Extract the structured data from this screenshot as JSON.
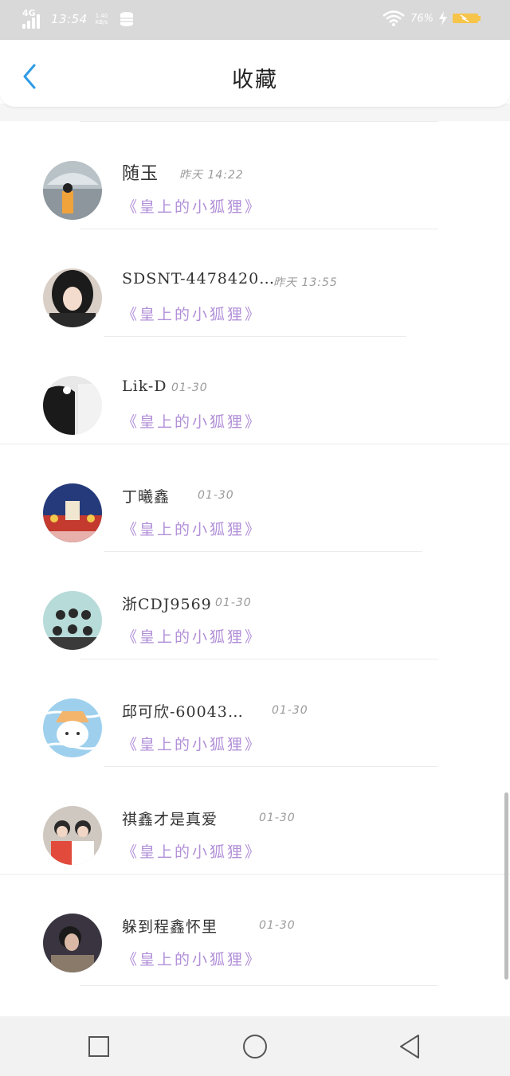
{
  "status_bar": {
    "network": "4G",
    "time": "13:54",
    "speed": "1.40 KB/s",
    "battery": "76%"
  },
  "header": {
    "title": "收藏",
    "back_icon": "chevron-left-icon"
  },
  "favorites": [
    {
      "name": "随玉",
      "date": "昨天 14:22",
      "song": "《皇上的小狐狸》",
      "avatar": "person-umbrella"
    },
    {
      "name": "SDSNT-4478420…",
      "date": "昨天 13:55",
      "song": "《皇上的小狐狸》",
      "avatar": "girl-dark-hair"
    },
    {
      "name": "Lik-D",
      "date": "01-30",
      "song": "《皇上的小狐狸》",
      "avatar": "mirror-selfie"
    },
    {
      "name": "丁曦鑫",
      "date": "01-30",
      "song": "《皇上的小狐狸》",
      "avatar": "stage-group"
    },
    {
      "name": "浙CDJ9569",
      "date": "01-30",
      "song": "《皇上的小狐狸》",
      "avatar": "boy-group"
    },
    {
      "name": "邱可欣-60043…",
      "date": "01-30",
      "song": "《皇上的小狐狸》",
      "avatar": "cartoon-bear-hat"
    },
    {
      "name": "祺鑫才是真爱",
      "date": "01-30",
      "song": "《皇上的小狐狸》",
      "avatar": "two-boys"
    },
    {
      "name": "躲到程鑫怀里",
      "date": "01-30",
      "song": "《皇上的小狐狸》",
      "avatar": "boy-dark"
    }
  ],
  "nav_bar": {
    "recent_icon": "square-recent-apps-icon",
    "home_icon": "circle-home-icon",
    "back_icon": "triangle-back-icon"
  },
  "colors": {
    "accent": "#2f9be6",
    "song_text": "#b18fd8",
    "status_bg": "#d9d9d9",
    "nav_bg": "#f2f2f2"
  }
}
